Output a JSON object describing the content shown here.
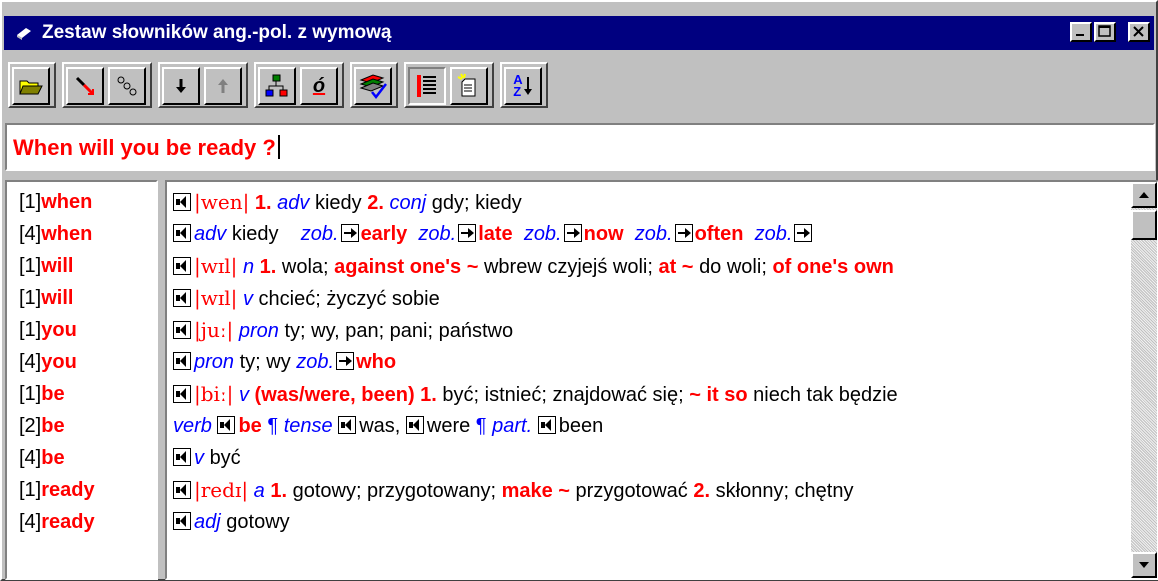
{
  "window": {
    "title": "Zestaw słowników ang.-pol. z wymową",
    "title_icon": "book-icon",
    "caption_buttons": [
      "minimize-icon",
      "maximize-icon",
      "close-icon"
    ]
  },
  "toolbar": {
    "buttons": [
      {
        "name": "open-folder",
        "icon": "open-folder-icon"
      },
      {
        "name": "link",
        "icon": "link-icon"
      },
      {
        "name": "unlink",
        "icon": "unlink-icon"
      },
      {
        "name": "next",
        "icon": "arrow-down-icon"
      },
      {
        "name": "previous",
        "icon": "arrow-up-icon"
      },
      {
        "name": "tree",
        "icon": "tree-icon"
      },
      {
        "name": "polish-chars",
        "icon": "polish-char-icon",
        "label": "ó"
      },
      {
        "name": "dictionaries",
        "icon": "books-check-icon"
      },
      {
        "name": "list",
        "icon": "list-icon"
      },
      {
        "name": "new-document",
        "icon": "new-document-icon"
      },
      {
        "name": "sort",
        "icon": "sort-az-icon",
        "label_top": "A",
        "label_bottom": "Z"
      }
    ]
  },
  "input": {
    "value": "When will you be ready ?"
  },
  "word_list": [
    {
      "index": "[1]",
      "word": "when"
    },
    {
      "index": "[4]",
      "word": "when"
    },
    {
      "index": "[1]",
      "word": "will"
    },
    {
      "index": "[1]",
      "word": "will"
    },
    {
      "index": "[1]",
      "word": "you"
    },
    {
      "index": "[4]",
      "word": "you"
    },
    {
      "index": "[1]",
      "word": "be"
    },
    {
      "index": "[2]",
      "word": "be"
    },
    {
      "index": "[4]",
      "word": "be"
    },
    {
      "index": "[1]",
      "word": "ready"
    },
    {
      "index": "[4]",
      "word": "ready"
    }
  ],
  "entries": {
    "r0": {
      "ph": "|wen|",
      "n1": "1.",
      "pos1": "adv",
      "t1": "kiedy",
      "n2": "2.",
      "pos2": "conj",
      "t2": "gdy; kiedy"
    },
    "r1": {
      "pos": "adv",
      "t": "kiedy",
      "zob": "zob.",
      "w1": "early",
      "w2": "late",
      "w3": "now",
      "w4": "often"
    },
    "r2": {
      "ph": "|wɪl|",
      "pos": "n",
      "n1": "1.",
      "t1": "wola;",
      "p1": "against one's ~",
      "t2": "wbrew czyjejś woli;",
      "p2": "at ~",
      "t3": "do woli;",
      "p3": "of one's own"
    },
    "r3": {
      "ph": "|wɪl|",
      "pos": "v",
      "t": "chcieć; życzyć sobie"
    },
    "r4": {
      "ph": "|juː|",
      "pos": "pron",
      "t": "ty; wy, pan; pani; państwo"
    },
    "r5": {
      "pos": "pron",
      "t": "ty; wy",
      "zob": "zob.",
      "w": "who"
    },
    "r6": {
      "ph": "|biː|",
      "pos": "v",
      "forms": "(was/were, been)",
      "n1": "1.",
      "t1": "być; istnieć; znajdować się;",
      "p1": "~ it so",
      "t2": "niech tak będzie"
    },
    "r7": {
      "l1": "verb",
      "w1": "be",
      "pil": "¶",
      "l2": "tense",
      "w2": "was,",
      "w3": "were",
      "l3": "part.",
      "w4": "been"
    },
    "r8": {
      "pos": "v",
      "t": "być"
    },
    "r9": {
      "ph": "|redɪ|",
      "pos": "a",
      "n1": "1.",
      "t1": "gotowy; przygotowany;",
      "p1": "make ~",
      "t2": "przygotować",
      "n2": "2.",
      "t3": "skłonny; chętny"
    },
    "r10": {
      "pos": "adj",
      "t": "gotowy"
    }
  },
  "colors": {
    "accent_red": "#ff0000",
    "pos_blue": "#0000ff",
    "titlebar": "#000080",
    "face": "#c0c0c0"
  }
}
